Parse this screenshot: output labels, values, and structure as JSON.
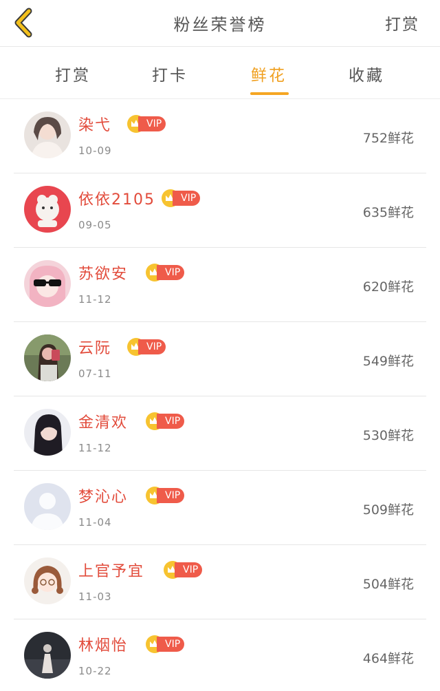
{
  "header": {
    "title": "粉丝荣誉榜",
    "action_label": "打赏",
    "back_icon": "chevron-left-icon",
    "accent_color": "#f5a623"
  },
  "tabs": [
    {
      "label": "打赏",
      "active": false
    },
    {
      "label": "打卡",
      "active": false
    },
    {
      "label": "鲜花",
      "active": true
    },
    {
      "label": "收藏",
      "active": false
    }
  ],
  "vip_label": "VIP",
  "fans": [
    {
      "name": "染弋",
      "date": "10-09",
      "count": "752鲜花"
    },
    {
      "name": "依依2105",
      "date": "09-05",
      "count": "635鲜花"
    },
    {
      "name": "苏欲安",
      "date": "11-12",
      "count": "620鲜花"
    },
    {
      "name": "云阮",
      "date": "07-11",
      "count": "549鲜花"
    },
    {
      "name": "金清欢",
      "date": "11-12",
      "count": "530鲜花"
    },
    {
      "name": "梦沁心",
      "date": "11-04",
      "count": "509鲜花"
    },
    {
      "name": "上官予宜",
      "date": "11-03",
      "count": "504鲜花"
    },
    {
      "name": "林烟怡",
      "date": "10-22",
      "count": "464鲜花"
    }
  ]
}
